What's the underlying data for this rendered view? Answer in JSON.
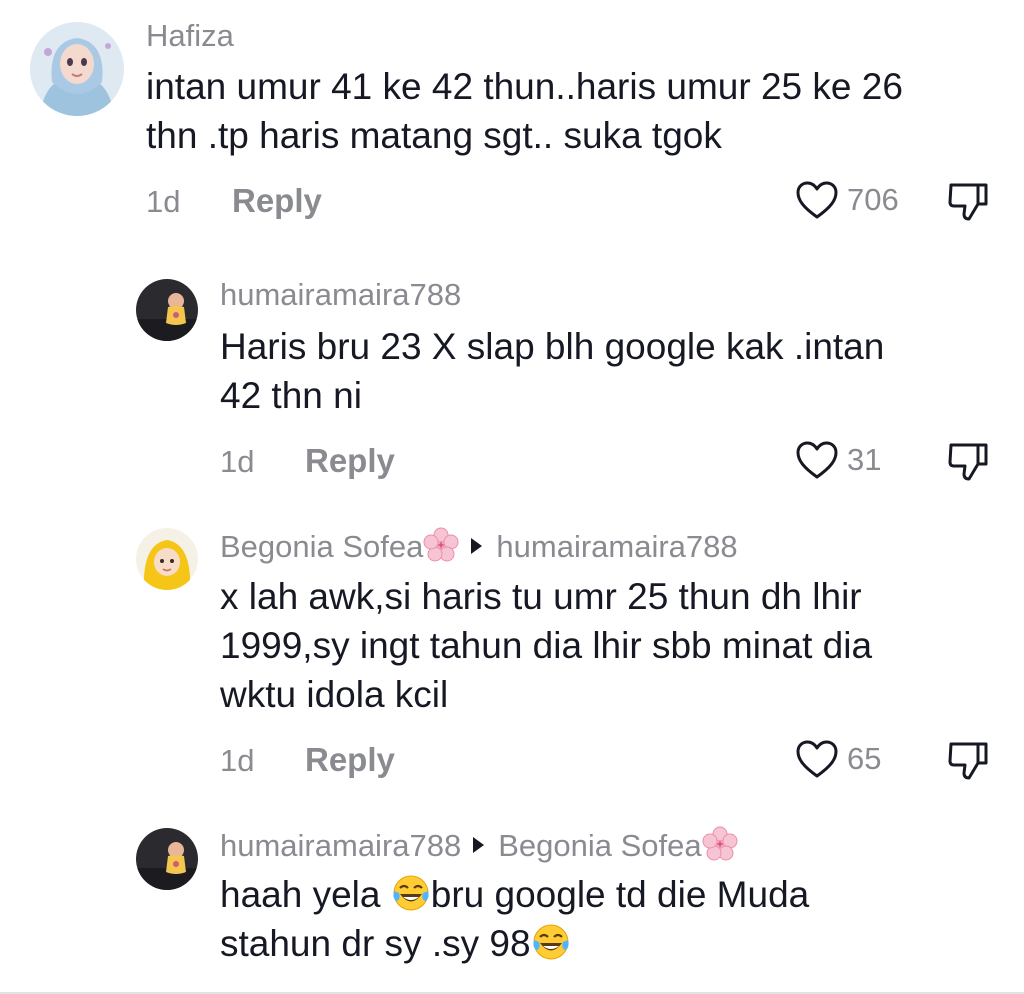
{
  "comments": [
    {
      "username": "Hafiza",
      "text_lines": [
        "intan umur 41 ke 42 thun..haris umur 25 ke 26",
        "thn .tp haris matang sgt.. suka tgok"
      ],
      "time": "1d",
      "reply_label": "Reply",
      "likes": "706"
    },
    {
      "username": "humairamaira788",
      "text_lines": [
        "Haris bru 23 X slap blh google kak .intan",
        "42 thn ni"
      ],
      "time": "1d",
      "reply_label": "Reply",
      "likes": "31"
    },
    {
      "username": "Begonia Sofea",
      "reply_to": "humairamaira788",
      "text_lines": [
        "x lah awk,si haris tu umr 25 thun dh lhir",
        "1999,sy ingt tahun dia lhir sbb minat dia",
        "wktu idola kcil"
      ],
      "time": "1d",
      "reply_label": "Reply",
      "likes": "65"
    },
    {
      "username": "humairamaira788",
      "reply_to": "Begonia Sofea",
      "text_line1_a": "haah yela ",
      "text_line1_b": "bru google td die Muda",
      "text_line2": "stahun dr sy .sy 98"
    }
  ],
  "icons": {
    "like": "heart-outline-icon",
    "dislike": "thumbs-down-outline-icon",
    "reply_arrow": "triangle-right-icon",
    "name_emoji": "cherry-blossom-icon",
    "laugh_emoji": "tears-of-joy-icon"
  },
  "colors": {
    "text": "#161823",
    "secondary": "#8a8b91",
    "background": "#ffffff"
  }
}
